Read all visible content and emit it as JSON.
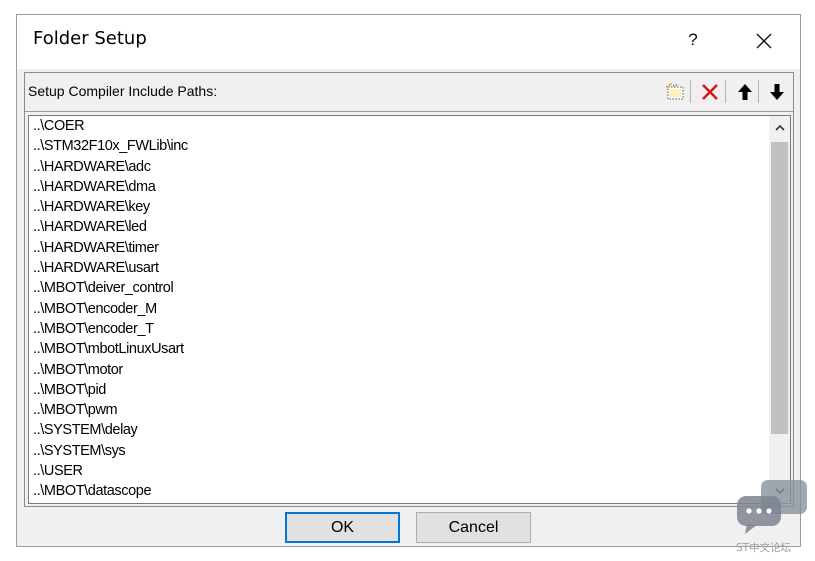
{
  "window": {
    "title": "Folder Setup",
    "help_label": "?"
  },
  "group": {
    "label": "Setup Compiler Include Paths:",
    "toolbar": {
      "new_icon": "new-folder-icon",
      "delete_icon": "delete-x-icon",
      "up_icon": "move-up-arrow-icon",
      "down_icon": "move-down-arrow-icon",
      "delete_color": "#d11a1a"
    }
  },
  "paths": [
    "..\\COER",
    "..\\STM32F10x_FWLib\\inc",
    "..\\HARDWARE\\adc",
    "..\\HARDWARE\\dma",
    "..\\HARDWARE\\key",
    "..\\HARDWARE\\led",
    "..\\HARDWARE\\timer",
    "..\\HARDWARE\\usart",
    "..\\MBOT\\deiver_control",
    "..\\MBOT\\encoder_M",
    "..\\MBOT\\encoder_T",
    "..\\MBOT\\mbotLinuxUsart",
    "..\\MBOT\\motor",
    "..\\MBOT\\pid",
    "..\\MBOT\\pwm",
    "..\\SYSTEM\\delay",
    "..\\SYSTEM\\sys",
    "..\\USER",
    "..\\MBOT\\datascope"
  ],
  "buttons": {
    "ok": "OK",
    "cancel": "Cancel"
  },
  "watermark": {
    "text": "ST中文论坛",
    "icon": "chat-bubble-icon"
  }
}
